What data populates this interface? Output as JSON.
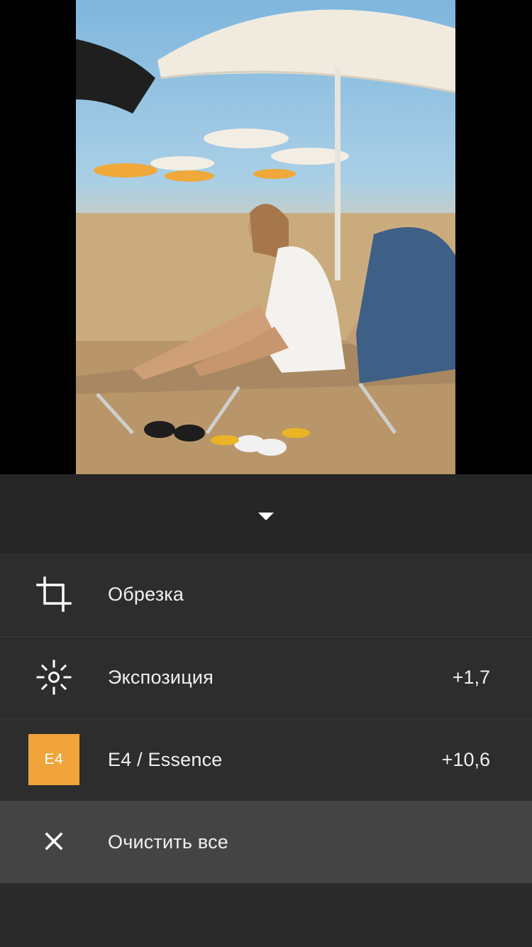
{
  "photo": {
    "description_icon": "beach-photo"
  },
  "collapse": {
    "icon": "caret-down-icon"
  },
  "history": [
    {
      "id": "crop",
      "icon": "crop-icon",
      "label": "Обрезка",
      "value": ""
    },
    {
      "id": "exposure",
      "icon": "sun-icon",
      "label": "Экспозиция",
      "value": "+1,7"
    },
    {
      "id": "preset",
      "badge": "E4",
      "badge_color": "#f0a43a",
      "label": "E4 / Essence",
      "value": "+10,6"
    }
  ],
  "clear": {
    "icon": "close-icon",
    "label": "Очистить все"
  }
}
